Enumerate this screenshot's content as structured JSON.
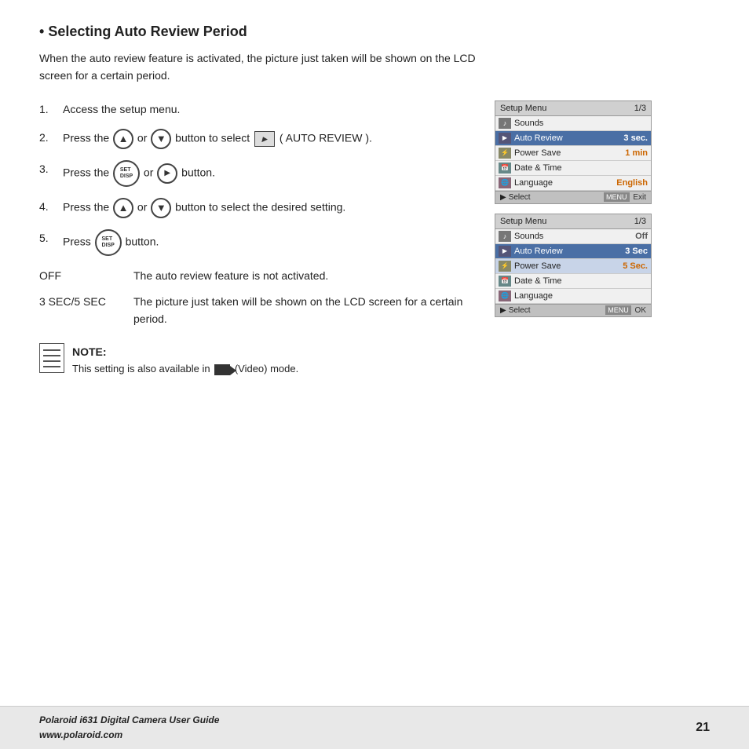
{
  "page": {
    "title": "Selecting Auto Review Period",
    "intro": "When the auto review feature is activated, the picture just taken will be shown on the LCD screen for a certain period.",
    "steps": [
      {
        "num": "1.",
        "text": "Access the setup menu."
      },
      {
        "num": "2.",
        "text": "Press the [UP] or [DOWN] button to select [AR] ( AUTO REVIEW )."
      },
      {
        "num": "3.",
        "text": "Press the [SET/DISP] or [OK] button."
      },
      {
        "num": "4.",
        "text": "Press the [UP] or [DOWN] button to select the desired setting."
      },
      {
        "num": "5.",
        "text": "Press [SET/DISP] button."
      }
    ],
    "definitions": [
      {
        "term": "OFF",
        "desc": "The auto review feature is not activated."
      },
      {
        "term": "3 SEC/5 SEC",
        "desc": "The picture just taken will be shown on the LCD screen for a certain period."
      }
    ],
    "note_label": "NOTE:",
    "note_text": "This setting is also available in",
    "note_suffix": "(Video) mode.",
    "menu1": {
      "header_left": "Setup Menu",
      "header_right": "1/3",
      "rows": [
        {
          "icon": "sound",
          "label": "Sounds",
          "value": "",
          "highlighted": false
        },
        {
          "icon": "ar",
          "label": "Auto Review",
          "value": "3 sec.",
          "highlighted": true
        },
        {
          "icon": "ps",
          "label": "Power Save",
          "value": "1 min",
          "highlighted": false
        },
        {
          "icon": "dt",
          "label": "Date & Time",
          "value": "",
          "highlighted": false
        },
        {
          "icon": "lang",
          "label": "Language",
          "value": "English",
          "highlighted": false
        }
      ],
      "footer_left": "Select",
      "footer_right": "Exit"
    },
    "menu2": {
      "header_left": "Setup Menu",
      "header_right": "1/3",
      "rows": [
        {
          "icon": "sound",
          "label": "Sounds",
          "value": "Off",
          "highlighted": false
        },
        {
          "icon": "ar",
          "label": "Auto Review",
          "value": "3 Sec",
          "highlighted": true
        },
        {
          "icon": "ps",
          "label": "Power Save",
          "value": "5 Sec.",
          "highlighted": false,
          "sub_highlighted": true
        },
        {
          "icon": "dt",
          "label": "Date & Time",
          "value": "",
          "highlighted": false
        },
        {
          "icon": "lang",
          "label": "Language",
          "value": "",
          "highlighted": false
        }
      ],
      "footer_left": "Select",
      "footer_right": "OK"
    },
    "footer": {
      "line1": "Polaroid i631 Digital Camera User Guide",
      "line2": "www.polaroid.com",
      "page": "21"
    }
  }
}
